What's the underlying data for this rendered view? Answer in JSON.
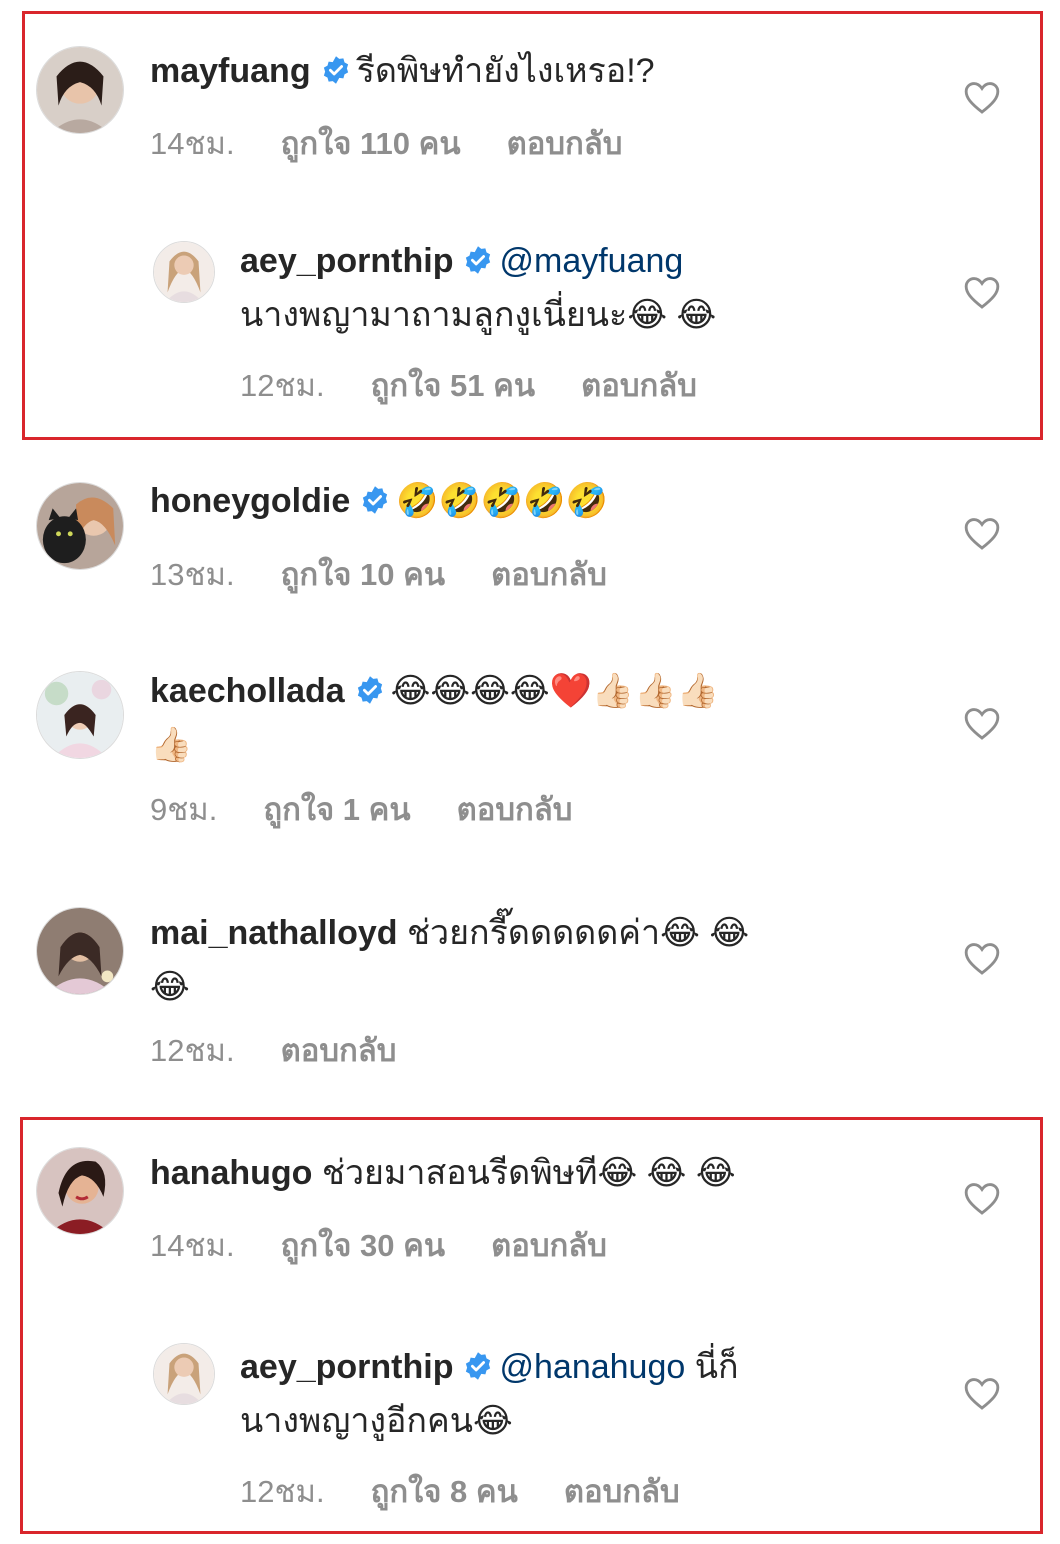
{
  "colors": {
    "highlight": "#d9262c",
    "verified": "#3897f0",
    "mention": "#00376b",
    "meta": "#8e8e8e",
    "text": "#262626"
  },
  "comments": [
    {
      "username": "mayfuang",
      "verified": true,
      "text": "รีดพิษทำยังไงเหรอ!?",
      "line2": "",
      "time": "14ชม.",
      "likes": "ถูกใจ 110 คน",
      "reply": "ตอบกลับ",
      "icon": "heart-outline-icon"
    },
    {
      "username": "aey_pornthip",
      "verified": true,
      "mention": "@mayfuang",
      "text": "",
      "line2": "นางพญามาถามลูกงูเนี่ยนะ😂 😂",
      "time": "12ชม.",
      "likes": "ถูกใจ 51 คน",
      "reply": "ตอบกลับ"
    },
    {
      "username": "honeygoldie",
      "verified": true,
      "text": "🤣🤣🤣🤣🤣",
      "line2": "",
      "time": "13ชม.",
      "likes": "ถูกใจ 10 คน",
      "reply": "ตอบกลับ"
    },
    {
      "username": "kaechollada",
      "verified": true,
      "text": "😂😂😂😂❤️👍🏻👍🏻👍🏻",
      "line2": "👍🏻",
      "time": "9ชม.",
      "likes": "ถูกใจ 1 คน",
      "reply": "ตอบกลับ"
    },
    {
      "username": "mai_nathalloyd",
      "verified": false,
      "text": "ช่วยกรี๊ดดดดดค่า😂 😂",
      "line2": "😂",
      "time": "12ชม.",
      "likes": "",
      "reply": "ตอบกลับ"
    },
    {
      "username": "hanahugo",
      "verified": false,
      "text": "ช่วยมาสอนรีดพิษที😂 😂 😂",
      "line2": "",
      "time": "14ชม.",
      "likes": "ถูกใจ 30 คน",
      "reply": "ตอบกลับ"
    },
    {
      "username": "aey_pornthip",
      "verified": true,
      "mention": "@hanahugo",
      "text": "นี่ก็",
      "line2": "นางพญางูอีกคน😂",
      "time": "12ชม.",
      "likes": "ถูกใจ 8 คน",
      "reply": "ตอบกลับ"
    }
  ]
}
